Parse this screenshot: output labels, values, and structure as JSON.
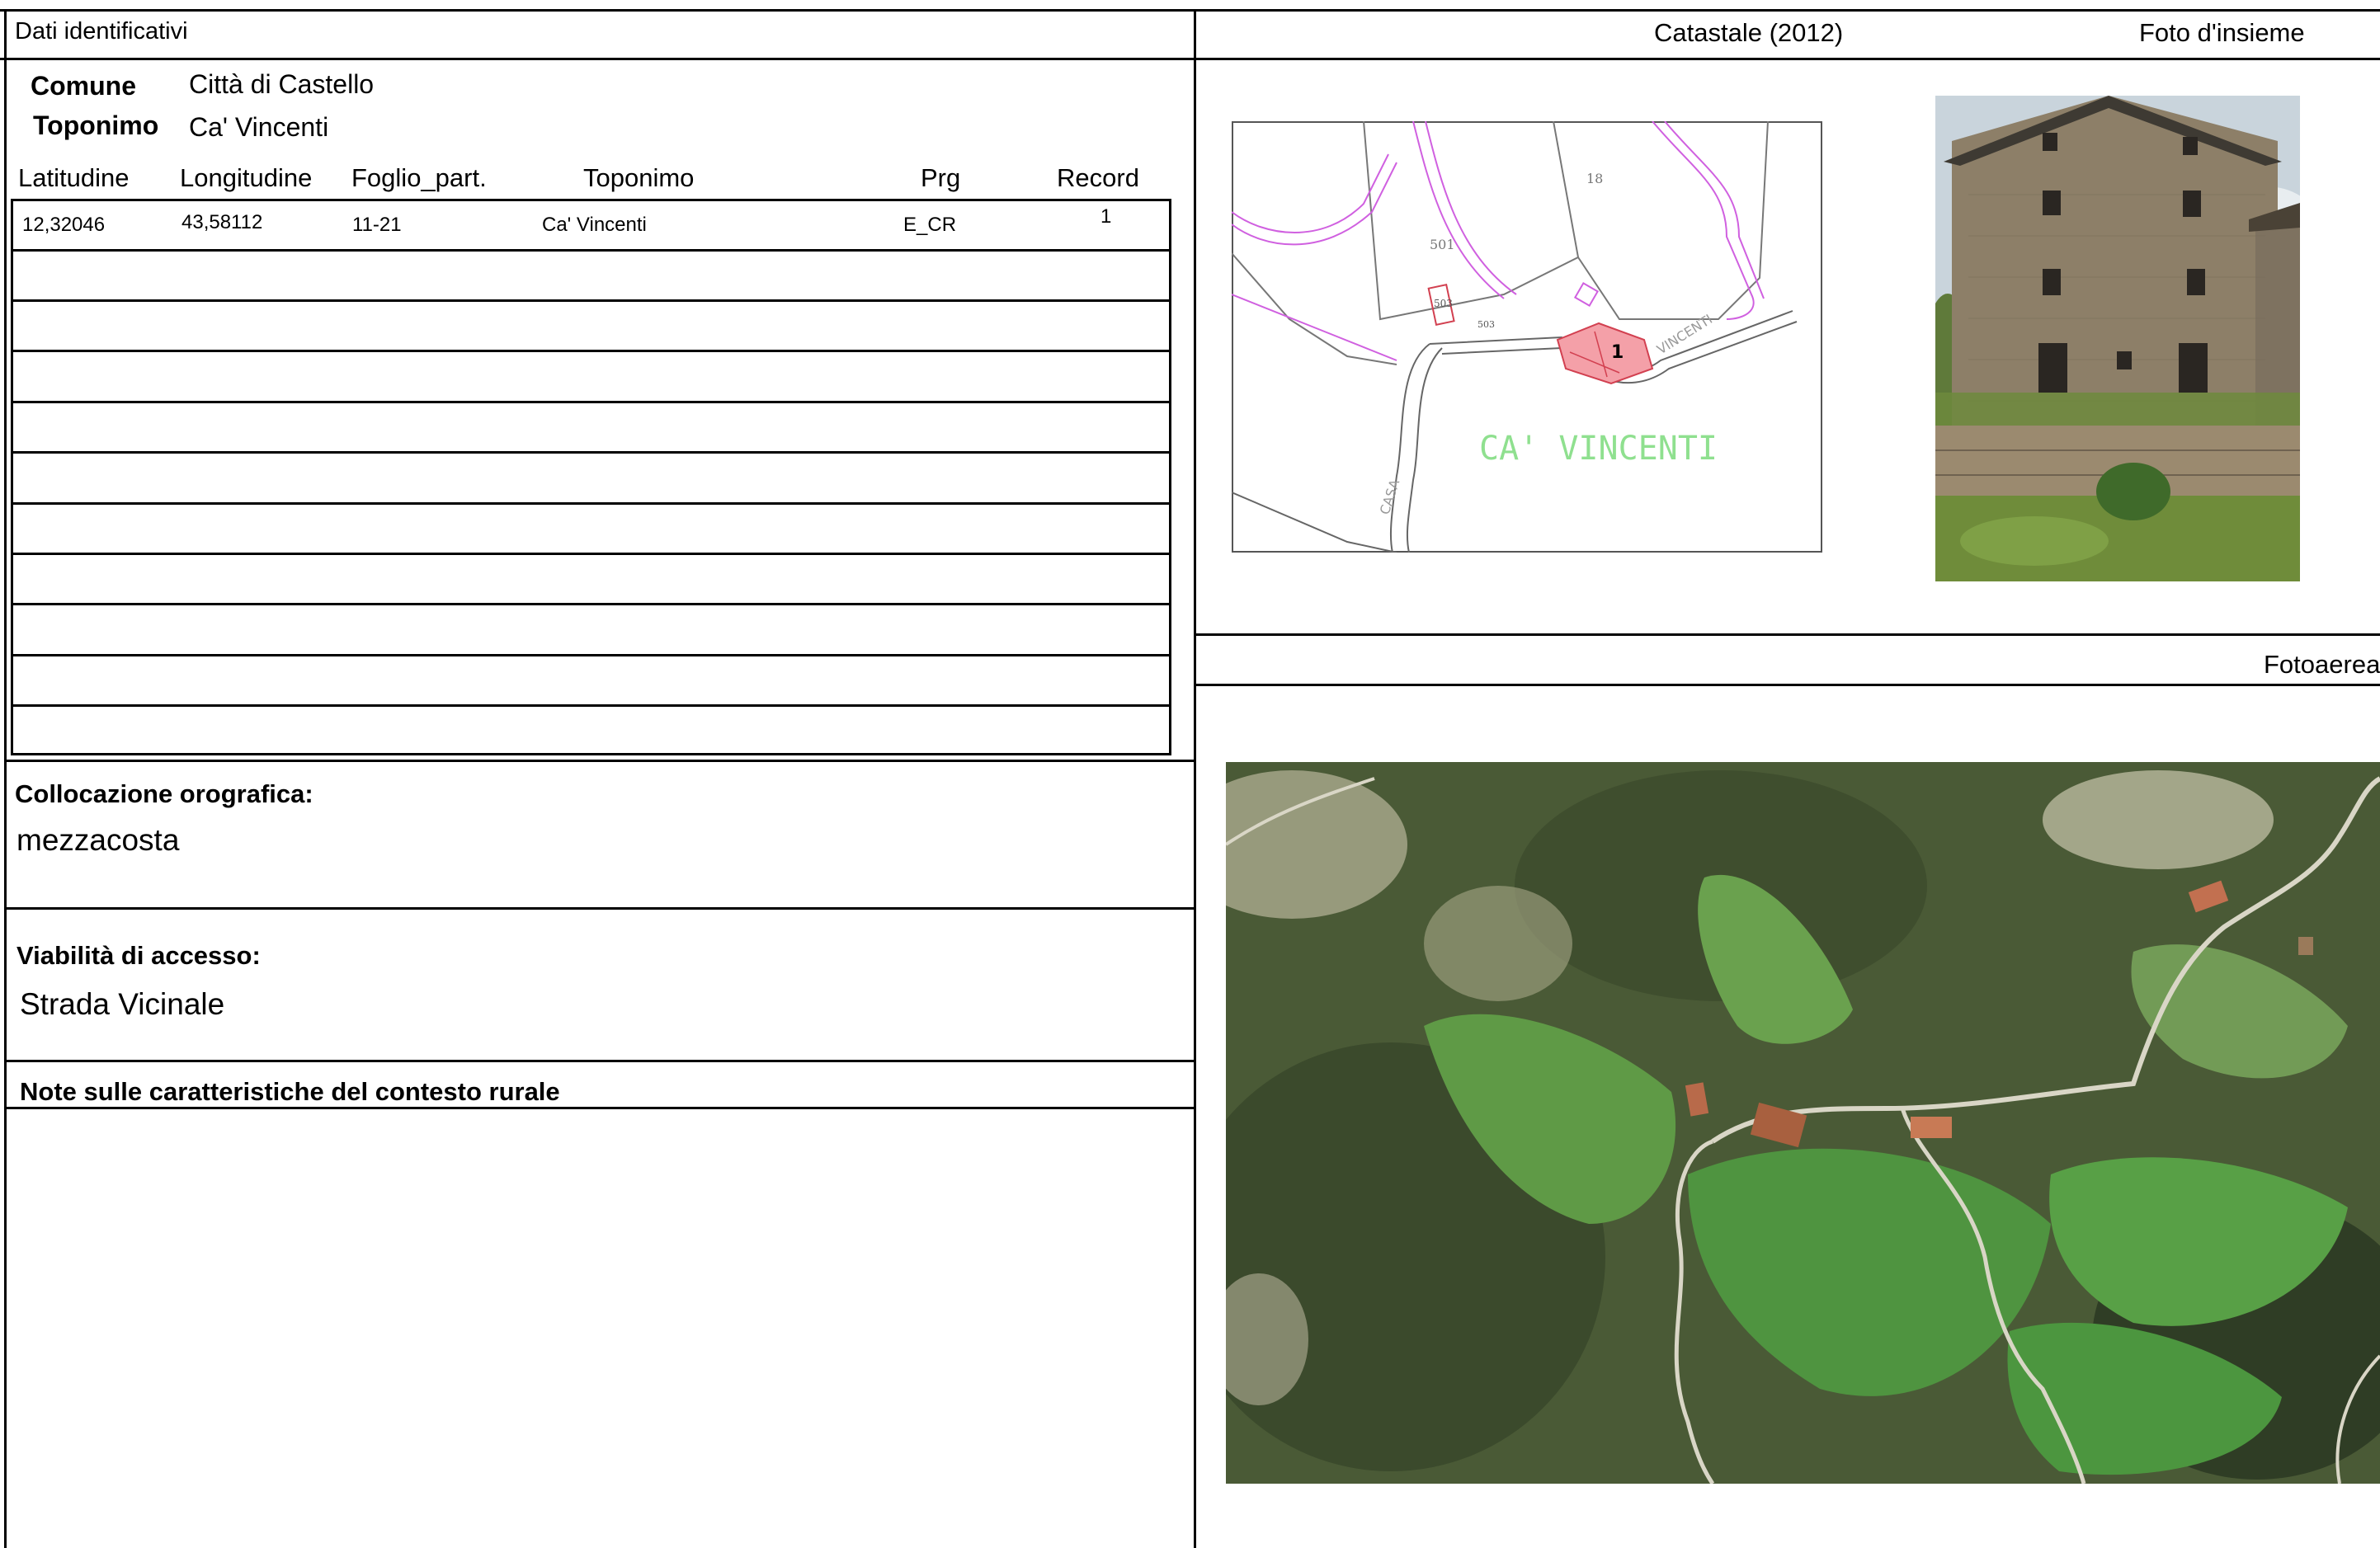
{
  "sections": {
    "identification": "Dati identificativi",
    "cadastral": "Catastale (2012)",
    "overview_photo": "Foto d'insieme",
    "aerial_photo": "Fotoaerea"
  },
  "fields": {
    "comune_label": "Comune",
    "comune_value": "Città di Castello",
    "toponimo_label": "Toponimo",
    "toponimo_value": "Ca' Vincenti"
  },
  "table": {
    "headers": [
      "Latitudine",
      "Longitudine",
      "Foglio_part.",
      "Toponimo",
      "Prg",
      "Record"
    ],
    "rows": [
      [
        "12,32046",
        "43,58112",
        "11-21",
        "Ca' Vincenti",
        "E_CR",
        "1"
      ]
    ],
    "empty_rows": 10
  },
  "orografica": {
    "label": "Collocazione orografica:",
    "value": "mezzacosta"
  },
  "viabilita": {
    "label": "Viabilità di accesso:",
    "value": "Strada Vicinale"
  },
  "note": {
    "label": "Note sulle caratteristiche del contesto rurale",
    "value": ""
  },
  "map": {
    "parcels": [
      "18",
      "501",
      "503",
      "503",
      "1"
    ],
    "place_label": "CA' VINCENTI",
    "road_labels": [
      "CASA",
      "VINCENTI"
    ],
    "colors": {
      "building_fill": "#f4a0a8",
      "building_stroke": "#d24050",
      "parcel_line": "#d060e0",
      "place_text": "#8fe08f"
    }
  }
}
